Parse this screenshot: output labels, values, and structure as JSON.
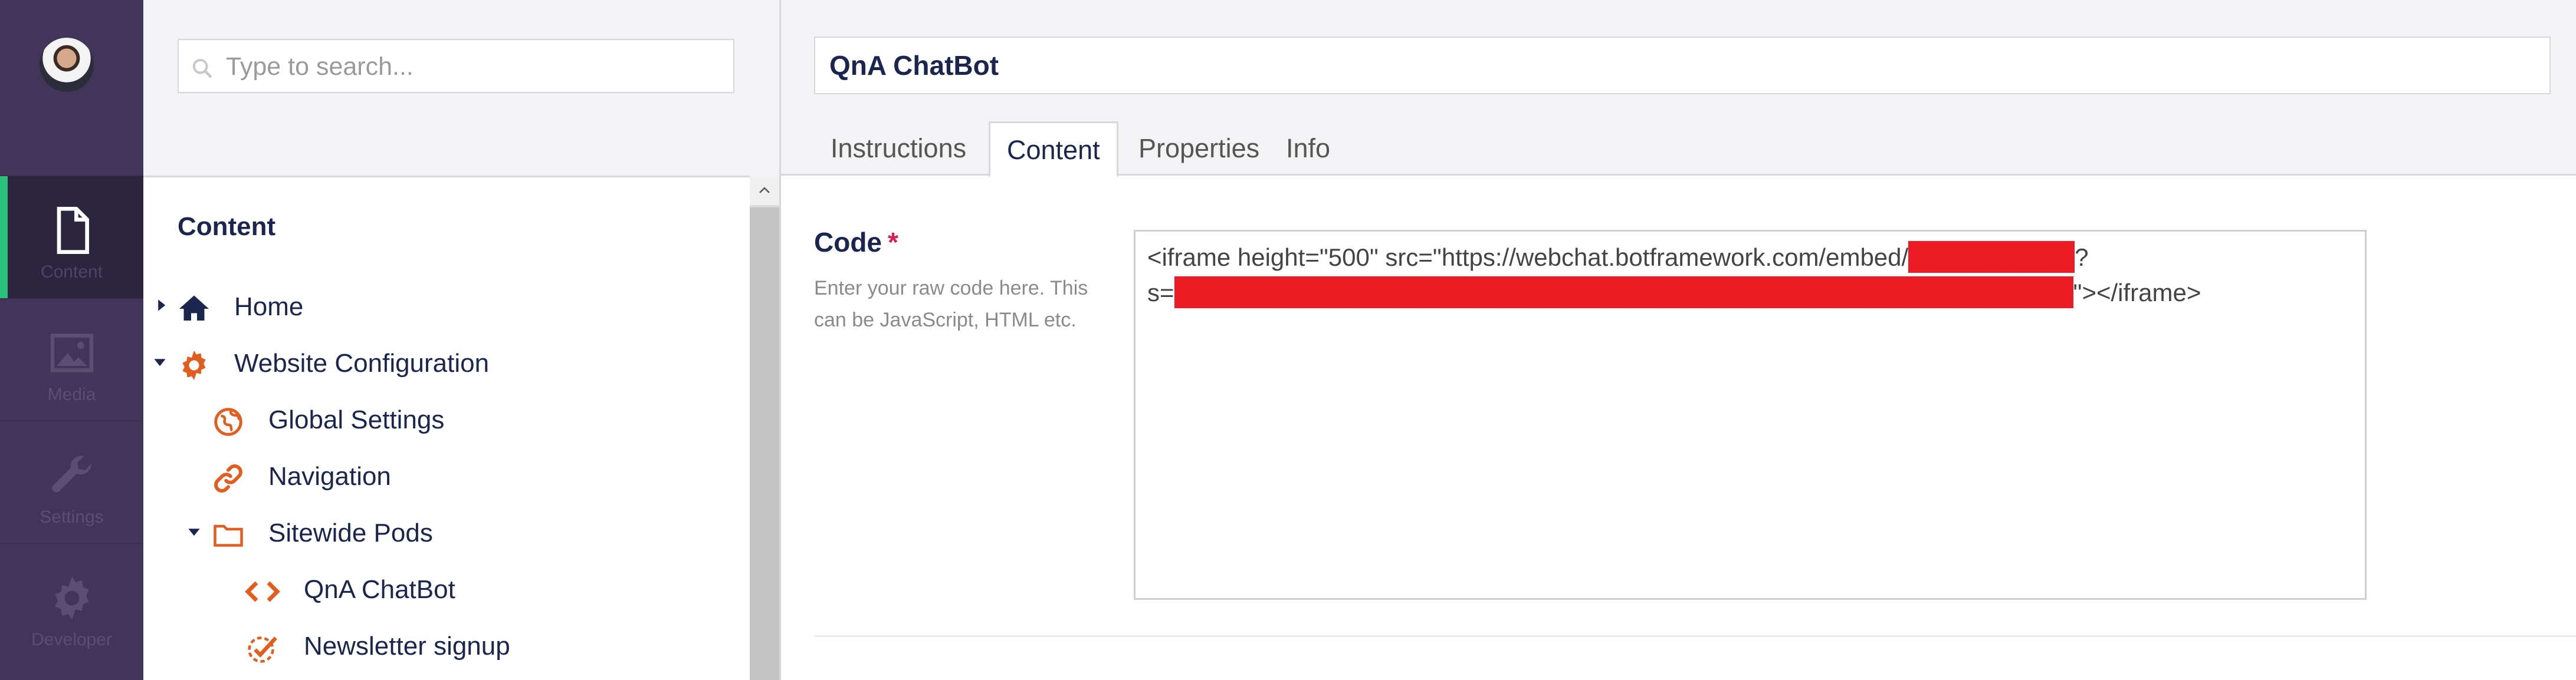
{
  "rail": {
    "items": [
      {
        "label": "Content",
        "icon": "document-icon",
        "active": true
      },
      {
        "label": "Media",
        "icon": "image-icon",
        "active": false
      },
      {
        "label": "Settings",
        "icon": "wrench-icon",
        "active": false
      },
      {
        "label": "Developer",
        "icon": "gear-icon",
        "active": false
      }
    ]
  },
  "tree": {
    "search_placeholder": "Type to search...",
    "title": "Content",
    "nodes": [
      {
        "label": "Home",
        "icon": "home-icon",
        "expanded": false
      },
      {
        "label": "Website Configuration",
        "icon": "gear-icon",
        "expanded": true
      },
      {
        "label": "Global Settings",
        "icon": "globe-icon"
      },
      {
        "label": "Navigation",
        "icon": "link-icon"
      },
      {
        "label": "Sitewide Pods",
        "icon": "folder-icon",
        "expanded": true
      },
      {
        "label": "QnA ChatBot",
        "icon": "code-icon"
      },
      {
        "label": "Newsletter signup",
        "icon": "check-circle-icon"
      }
    ]
  },
  "editor": {
    "name": "QnA ChatBot",
    "tabs": [
      {
        "label": "Instructions",
        "active": false
      },
      {
        "label": "Content",
        "active": true
      },
      {
        "label": "Properties",
        "active": false
      },
      {
        "label": "Info",
        "active": false
      }
    ],
    "property": {
      "label": "Code",
      "required_mark": "*",
      "description": "Enter your raw code here. This can be JavaScript, HTML etc.",
      "code_line1_prefix": "<iframe height=\"500\" src=\"https://webchat.botframework.com/embed/",
      "code_line1_suffix": "?",
      "code_line2_prefix": "s=",
      "code_line2_suffix": "\"></iframe>"
    }
  },
  "colors": {
    "rail_bg": "#413659",
    "rail_active_bar": "#2bc37c",
    "tree_icon_orange": "#e05e20",
    "redaction": "#ed1c24",
    "required": "#d42054"
  }
}
